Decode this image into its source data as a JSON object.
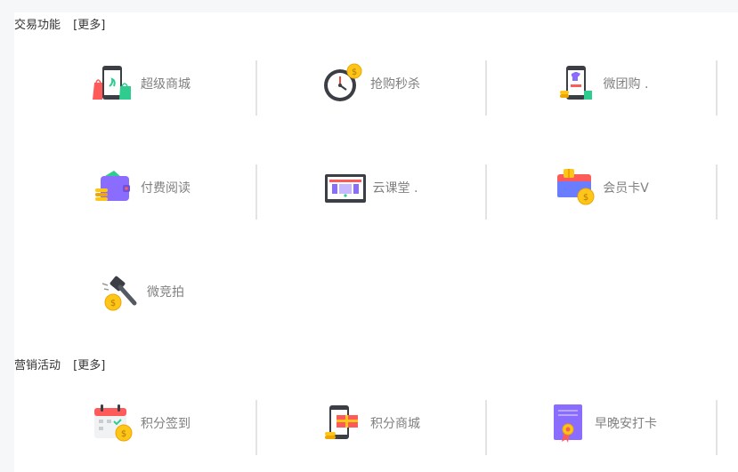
{
  "sections": [
    {
      "title": "交易功能",
      "more": "[更多]",
      "items": [
        {
          "label": "超级商城",
          "icon": "mall-phone-bags-icon"
        },
        {
          "label": "抢购秒杀",
          "icon": "clock-coin-icon"
        },
        {
          "label": "微团购 .",
          "icon": "phone-tshirt-icon"
        },
        {
          "label": "付费阅读",
          "icon": "wallet-coins-icon"
        },
        {
          "label": "云课堂 .",
          "icon": "monitor-icon"
        },
        {
          "label": "会员卡V",
          "icon": "vip-card-icon"
        },
        {
          "label": "微竞拍",
          "icon": "auction-gavel-icon"
        }
      ]
    },
    {
      "title": "营销活动",
      "more": "[更多]",
      "items": [
        {
          "label": "积分签到",
          "icon": "calendar-coin-icon"
        },
        {
          "label": "积分商城",
          "icon": "phone-gift-icon"
        },
        {
          "label": "早晚安打卡",
          "icon": "certificate-icon"
        }
      ]
    }
  ],
  "colors": {
    "accent_green": "#2ecc8f",
    "accent_red": "#ff5a5a",
    "coin": "#ffc61a",
    "purple": "#8a6cff"
  }
}
